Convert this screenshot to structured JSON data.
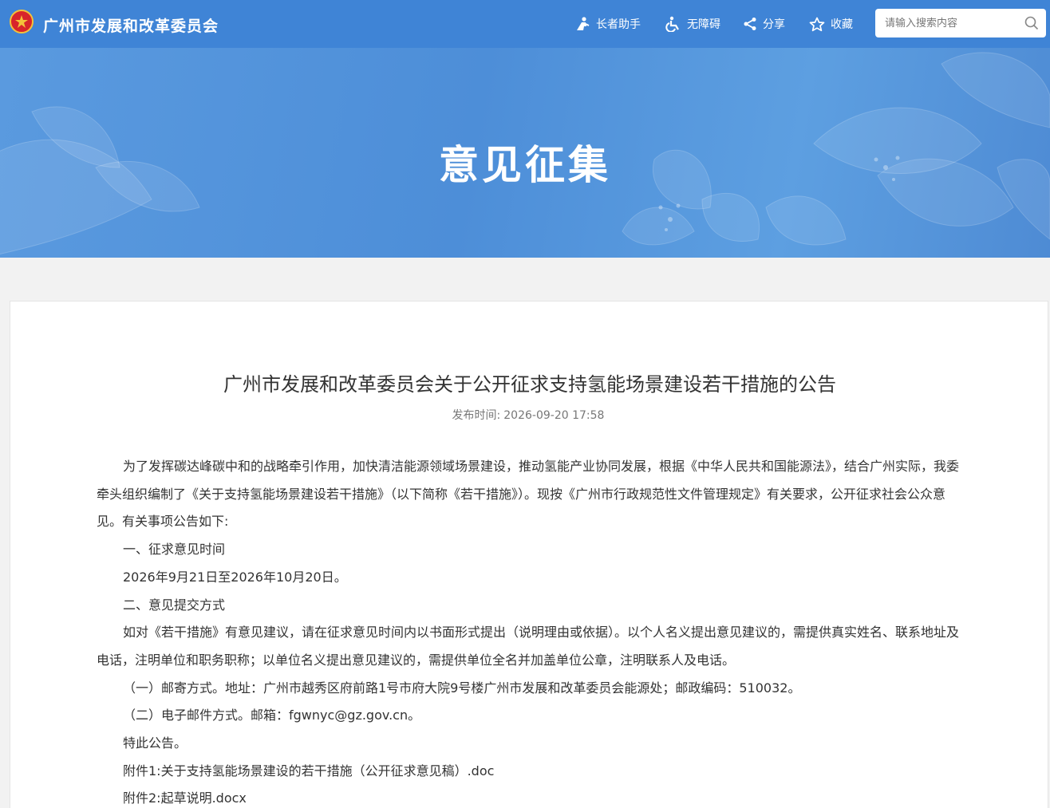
{
  "header": {
    "site_name": "广州市发展和改革委员会",
    "tools": {
      "elder": "长者助手",
      "accessibility": "无障碍",
      "share": "分享",
      "favorite": "收藏"
    },
    "search_placeholder": "请输入搜索内容"
  },
  "banner": {
    "title": "意见征集"
  },
  "article": {
    "title": "广州市发展和改革委员会关于公开征求支持氢能场景建设若干措施的公告",
    "publish_label": "发布时间:",
    "publish_time": "2026-09-20 17:58",
    "paragraphs": [
      "为了发挥碳达峰碳中和的战略牵引作用，加快清洁能源领域场景建设，推动氢能产业协同发展，根据《中华人民共和国能源法》，结合广州实际，我委牵头组织编制了《关于支持氢能场景建设若干措施》（以下简称《若干措施》）。现按《广州市行政规范性文件管理规定》有关要求，公开征求社会公众意见。有关事项公告如下:",
      "一、征求意见时间",
      "2026年9月21日至2026年10月20日。",
      "二、意见提交方式",
      "如对《若干措施》有意见建议，请在征求意见时间内以书面形式提出（说明理由或依据）。以个人名义提出意见建议的，需提供真实姓名、联系地址及电话，注明单位和职务职称；以单位名义提出意见建议的，需提供单位全名并加盖单位公章，注明联系人及电话。",
      "（一）邮寄方式。地址：广州市越秀区府前路1号市府大院9号楼广州市发展和改革委员会能源处；邮政编码：510032。",
      "（二）电子邮件方式。邮箱：fgwnyc@gz.gov.cn。",
      "特此公告。"
    ],
    "attachments": [
      "附件1:关于支持氢能场景建设的若干措施（公开征求意见稿）.doc",
      "附件2:起草说明.docx"
    ]
  },
  "colors": {
    "header_bg": "#3f84d6",
    "banner_bg": "#5596dc",
    "emblem_red": "#d8252a",
    "emblem_gold": "#f3c23a"
  }
}
